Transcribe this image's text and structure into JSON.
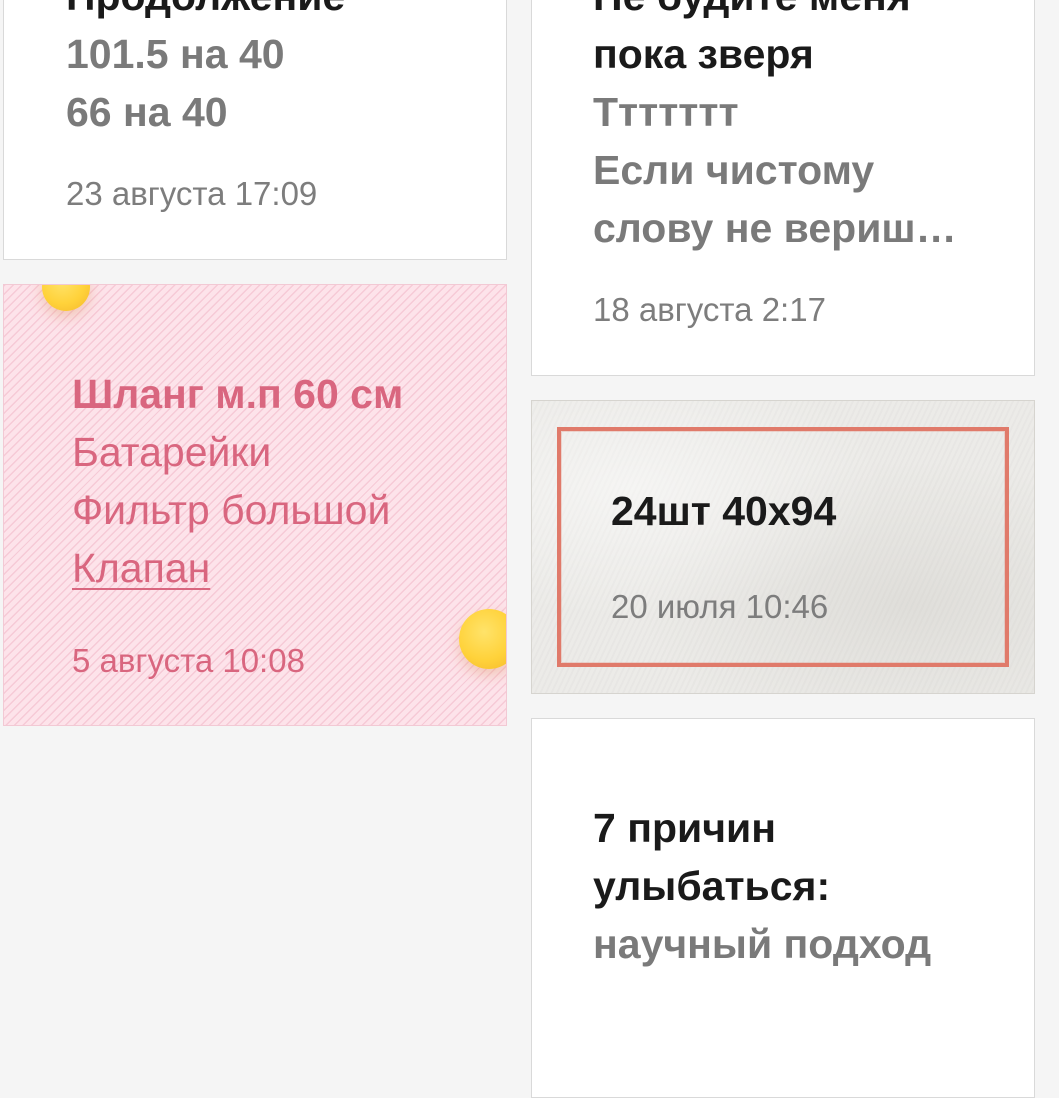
{
  "notes": [
    {
      "lines": [
        "Продолжение",
        "101.5 на 40",
        "66 на 40"
      ],
      "date": "23 августа 17:09"
    },
    {
      "lines": [
        "Не будите меня",
        "пока зверя",
        "Ттттттт",
        "Если чистому",
        "слову не вериш…"
      ],
      "date": "18 августа 2:17"
    },
    {
      "lines": [
        "Шланг м.п 60 см",
        "Батарейки",
        "Фильтр большой",
        "Клапан"
      ],
      "date": "5 августа 10:08",
      "color": "#d9667f"
    },
    {
      "lines": [
        "24шт 40х94"
      ],
      "date": "20 июля 10:46",
      "frame_color": "#e07a6a"
    },
    {
      "lines": [
        "7 причин",
        "улыбаться:",
        "научный подход"
      ]
    }
  ]
}
